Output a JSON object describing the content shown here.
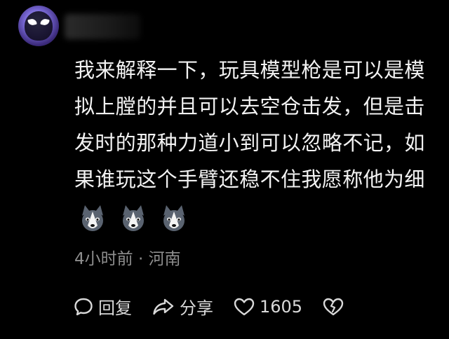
{
  "comment": {
    "lines": [
      "我来解释一下，玩具模型枪是可以是模",
      "拟上膛的并且可以去空仓击发，但是击",
      "发时的那种力道小到可以忽略不记，如",
      "果谁玩这个手臂还稳不住我愿称他为细"
    ],
    "emoji_icons": [
      "husky-emoji-icon",
      "husky-emoji-icon",
      "husky-emoji-icon"
    ]
  },
  "meta": {
    "time_location": "4小时前 · 河南"
  },
  "actions": {
    "reply_label": "回复",
    "share_label": "分享",
    "like_count": "1605"
  },
  "colors": {
    "background": "#000000",
    "text": "#f2f2f2",
    "muted": "#8e8e8e"
  }
}
